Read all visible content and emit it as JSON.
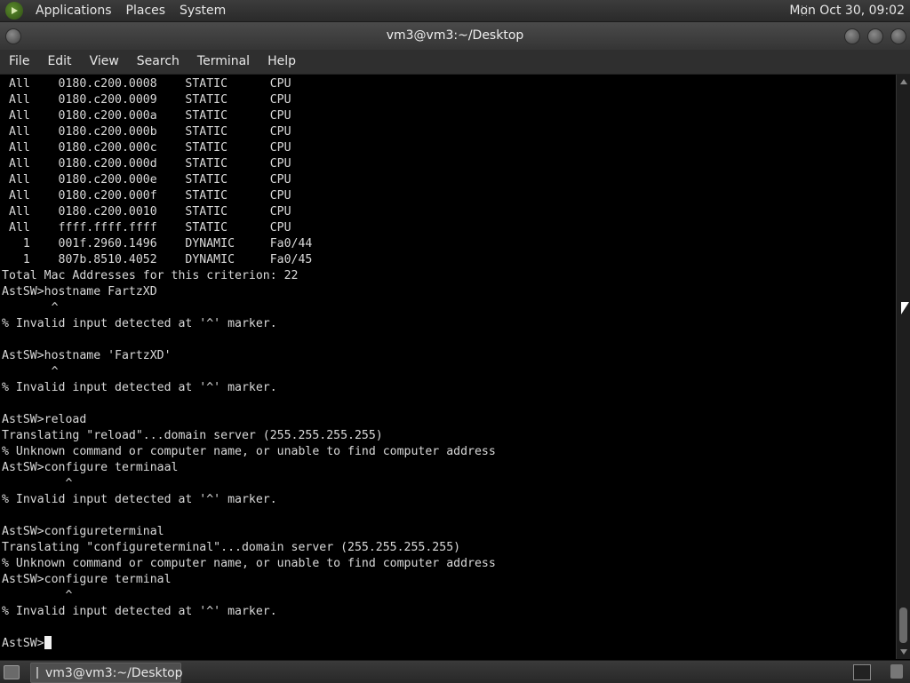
{
  "top_panel": {
    "menus": [
      "Applications",
      "Places",
      "System"
    ],
    "clock": "Mon Oct 30, 09:02"
  },
  "window": {
    "title": "vm3@vm3:~/Desktop"
  },
  "menubar": [
    "File",
    "Edit",
    "View",
    "Search",
    "Terminal",
    "Help"
  ],
  "terminal": {
    "lines": [
      " All    0180.c200.0008    STATIC      CPU",
      " All    0180.c200.0009    STATIC      CPU",
      " All    0180.c200.000a    STATIC      CPU",
      " All    0180.c200.000b    STATIC      CPU",
      " All    0180.c200.000c    STATIC      CPU",
      " All    0180.c200.000d    STATIC      CPU",
      " All    0180.c200.000e    STATIC      CPU",
      " All    0180.c200.000f    STATIC      CPU",
      " All    0180.c200.0010    STATIC      CPU",
      " All    ffff.ffff.ffff    STATIC      CPU",
      "   1    001f.2960.1496    DYNAMIC     Fa0/44",
      "   1    807b.8510.4052    DYNAMIC     Fa0/45",
      "Total Mac Addresses for this criterion: 22",
      "AstSW>hostname FartzXD",
      "       ^",
      "% Invalid input detected at '^' marker.",
      "",
      "AstSW>hostname 'FartzXD'",
      "       ^",
      "% Invalid input detected at '^' marker.",
      "",
      "AstSW>reload",
      "Translating \"reload\"...domain server (255.255.255.255)",
      "% Unknown command or computer name, or unable to find computer address",
      "AstSW>configure terminaal",
      "         ^",
      "% Invalid input detected at '^' marker.",
      "",
      "AstSW>configureterminal",
      "Translating \"configureterminal\"...domain server (255.255.255.255)",
      "% Unknown command or computer name, or unable to find computer address",
      "AstSW>configure terminal",
      "         ^",
      "% Invalid input detected at '^' marker.",
      ""
    ],
    "prompt": "AstSW>"
  },
  "bottom_panel": {
    "task_label": "vm3@vm3:~/Desktop"
  }
}
